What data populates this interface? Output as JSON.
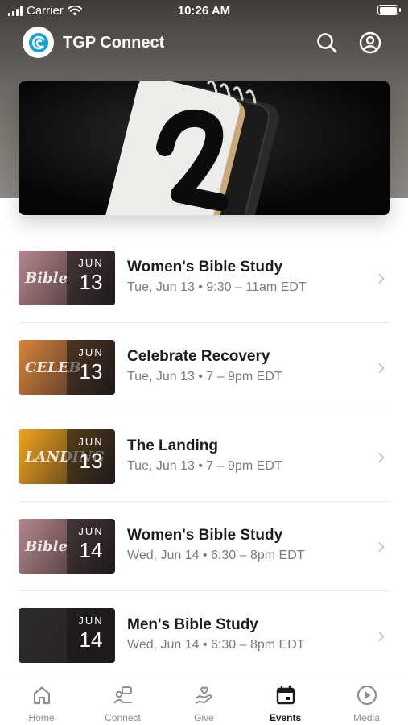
{
  "status_bar": {
    "carrier": "Carrier",
    "time": "10:26 AM"
  },
  "app": {
    "title": "TGP Connect",
    "logo_icon": "swirl-logo-icon",
    "search_icon": "search-icon",
    "profile_icon": "user-circle-icon"
  },
  "hero": {
    "digit": "2",
    "icon": "calendar-flip-icon"
  },
  "events": [
    {
      "title": "Women's Bible Study",
      "subtitle": "Tue, Jun 13 • 9:30 – 11am EDT",
      "month": "JUN",
      "day": "13",
      "thumb_text": "Bible",
      "thumb_color": "#b5878c"
    },
    {
      "title": "Celebrate Recovery",
      "subtitle": "Tue, Jun 13 • 7 – 9pm EDT",
      "month": "JUN",
      "day": "13",
      "thumb_text": "CELEB",
      "thumb_color": "#d8843a"
    },
    {
      "title": "The Landing",
      "subtitle": "Tue, Jun 13 • 7 – 9pm EDT",
      "month": "JUN",
      "day": "13",
      "thumb_text": "LANDING",
      "thumb_color": "#f0a51a"
    },
    {
      "title": "Women's Bible Study",
      "subtitle": "Wed, Jun 14 • 6:30 – 8pm EDT",
      "month": "JUN",
      "day": "14",
      "thumb_text": "Bible",
      "thumb_color": "#b5878c"
    },
    {
      "title": "Men's Bible Study",
      "subtitle": "Wed, Jun 14 • 6:30 – 8pm EDT",
      "month": "JUN",
      "day": "14",
      "thumb_text": "",
      "thumb_color": "#2b2b2b"
    }
  ],
  "tabs": [
    {
      "label": "Home",
      "icon": "home-icon",
      "active": false
    },
    {
      "label": "Connect",
      "icon": "connect-icon",
      "active": false
    },
    {
      "label": "Give",
      "icon": "give-hand-heart-icon",
      "active": false
    },
    {
      "label": "Events",
      "icon": "calendar-icon",
      "active": true
    },
    {
      "label": "Media",
      "icon": "play-circle-icon",
      "active": false
    }
  ],
  "colors": {
    "header_top": "#3e3b38",
    "header_bottom": "#8c8985",
    "logo_blue": "#1aa1d6",
    "text_primary": "#1c1c1e",
    "text_secondary": "#7b7b80",
    "tab_inactive": "#8e8e93"
  }
}
